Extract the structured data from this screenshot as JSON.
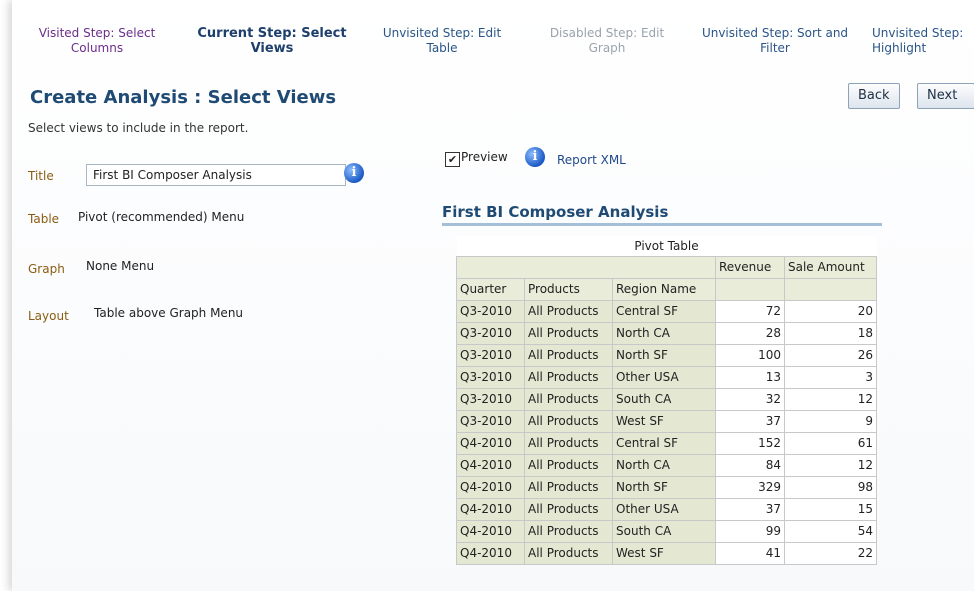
{
  "train": {
    "steps": [
      {
        "label": "Visited Step: Select Columns"
      },
      {
        "label": "Current Step: Select Views"
      },
      {
        "label": "Unvisited Step: Edit Table"
      },
      {
        "label": "Disabled Step: Edit Graph"
      },
      {
        "label": "Unvisited Step: Sort and Filter"
      },
      {
        "label": "Unvisited Step: Highlight"
      }
    ]
  },
  "header": {
    "title": "Create Analysis : Select Views",
    "instruction": "Select views to include in the report.",
    "back_label": "Back",
    "next_label": "Next"
  },
  "form": {
    "title_label": "Title",
    "title_value": "First BI Composer Analysis",
    "table_label": "Table",
    "table_value": "Pivot (recommended) Menu",
    "graph_label": "Graph",
    "graph_value": "None Menu",
    "layout_label": "Layout",
    "layout_value": "Table above Graph Menu"
  },
  "preview": {
    "label": "Preview",
    "checked": true,
    "report_xml": "Report XML",
    "report_title": "First BI Composer Analysis",
    "table_caption": "Pivot Table",
    "measure_headers": [
      "Revenue",
      "Sale Amount"
    ],
    "row_headers": [
      "Quarter",
      "Products",
      "Region Name"
    ],
    "rows": [
      [
        "Q3-2010",
        "All Products",
        "Central SF",
        "72",
        "20"
      ],
      [
        "Q3-2010",
        "All Products",
        "North CA",
        "28",
        "18"
      ],
      [
        "Q3-2010",
        "All Products",
        "North SF",
        "100",
        "26"
      ],
      [
        "Q3-2010",
        "All Products",
        "Other USA",
        "13",
        "3"
      ],
      [
        "Q3-2010",
        "All Products",
        "South CA",
        "32",
        "12"
      ],
      [
        "Q3-2010",
        "All Products",
        "West SF",
        "37",
        "9"
      ],
      [
        "Q4-2010",
        "All Products",
        "Central SF",
        "152",
        "61"
      ],
      [
        "Q4-2010",
        "All Products",
        "North CA",
        "84",
        "12"
      ],
      [
        "Q4-2010",
        "All Products",
        "North SF",
        "329",
        "98"
      ],
      [
        "Q4-2010",
        "All Products",
        "Other USA",
        "37",
        "15"
      ],
      [
        "Q4-2010",
        "All Products",
        "South CA",
        "99",
        "54"
      ],
      [
        "Q4-2010",
        "All Products",
        "West SF",
        "41",
        "22"
      ]
    ]
  },
  "icons": {
    "info": "info-icon",
    "info_glyph": "i",
    "checkbox_glyph": "✔"
  },
  "colors": {
    "title": "#1f4a73",
    "visited_step": "#6b2d8a",
    "disabled_step": "#9aa3ad",
    "field_label": "#8a5c12",
    "pivot_header": "#e9ecd8"
  }
}
